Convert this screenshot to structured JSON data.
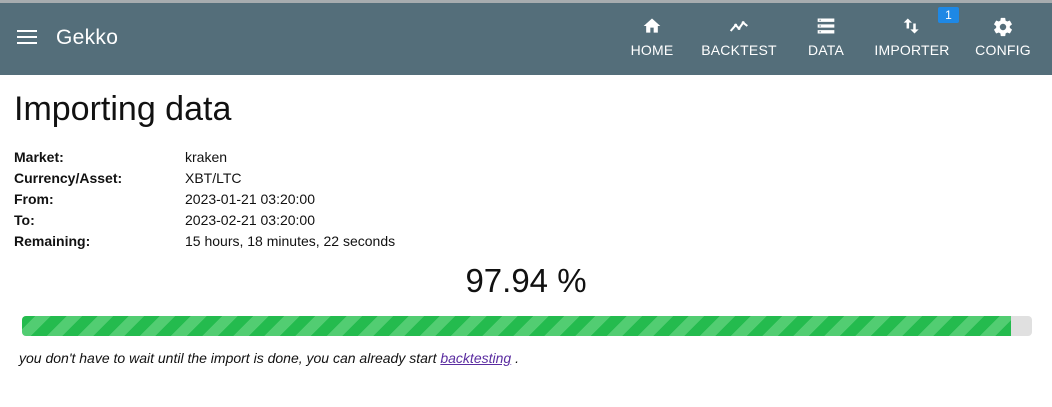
{
  "app": {
    "title": "Gekko"
  },
  "nav": {
    "items": [
      {
        "label": "HOME",
        "icon": "home-icon"
      },
      {
        "label": "BACKTEST",
        "icon": "chart-line-icon"
      },
      {
        "label": "DATA",
        "icon": "storage-icon"
      },
      {
        "label": "IMPORTER",
        "icon": "import-export-icon",
        "badge": "1"
      },
      {
        "label": "CONFIG",
        "icon": "gear-icon"
      }
    ]
  },
  "page": {
    "title": "Importing data",
    "details": [
      {
        "label": "Market:",
        "value": "kraken"
      },
      {
        "label": "Currency/Asset:",
        "value": "XBT/LTC"
      },
      {
        "label": "From:",
        "value": "2023-01-21 03:20:00"
      },
      {
        "label": "To:",
        "value": "2023-02-21 03:20:00"
      },
      {
        "label": "Remaining:",
        "value": "15 hours, 18 minutes, 22 seconds"
      }
    ],
    "progress_text": "97.94 %",
    "progress_fraction": 0.9794,
    "note_prefix": "you don't have to wait until the import is done, you can already start",
    "note_link": "backtesting",
    "note_suffix": "."
  },
  "colors": {
    "navbar": "#546e7a",
    "progress": "#24bb4e",
    "progress_stripe": "#52cd72",
    "badge": "#1e88e5",
    "link": "#5a2ca0"
  }
}
